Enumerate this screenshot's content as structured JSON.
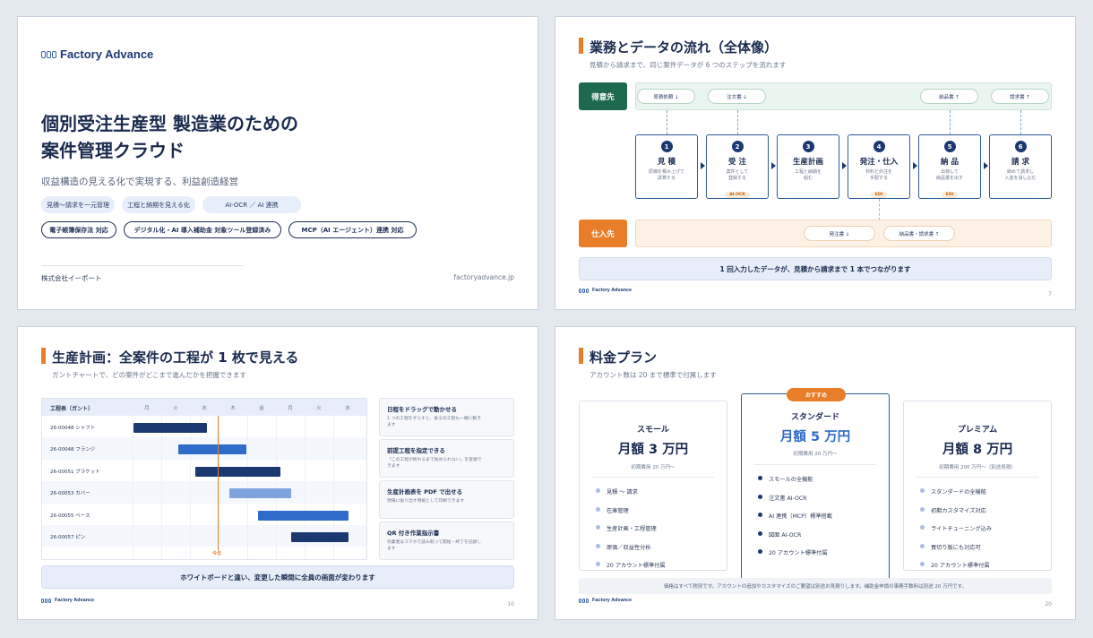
{
  "slide1": {
    "logo_text": "Factory Advance",
    "title_line1": "個別受注生産型 製造業のための",
    "title_line2": "案件管理クラウド",
    "subtitle": "収益構造の見える化で実現する、利益創造経営",
    "tags_light": [
      "見積〜請求を一元管理",
      "工程と納期を見える化",
      "AI-OCR ／ AI 連携"
    ],
    "tags_outline": [
      "電子帳簿保存法 対応",
      "デジタル化・AI 導入補助金 対象ツール登録済み",
      "MCP（AI エージェント）連携 対応"
    ],
    "company": "株式会社イーポート",
    "url": "factoryadvance.jp"
  },
  "slide2": {
    "title": "業務とデータの流れ（全体像）",
    "subtitle": "見積から請求まで、同じ案件データが 6 つのステップを流れます",
    "customer_label": "得意先",
    "supplier_label": "仕入先",
    "customer_chips": [
      "見積依頼 ↓",
      "注文書 ↓",
      "納品書 ↑",
      "請求書 ↑"
    ],
    "supplier_chips": [
      "発注書 ↓",
      "納品書・請求書 ↑"
    ],
    "steps": [
      {
        "num": "1",
        "name": "見 積",
        "desc1": "原価を積み上げて",
        "desc2": "試算する",
        "tag": ""
      },
      {
        "num": "2",
        "name": "受 注",
        "desc1": "案件として",
        "desc2": "登録する",
        "tag": "AI-OCR"
      },
      {
        "num": "3",
        "name": "生産計画",
        "desc1": "工程と納期を",
        "desc2": "組む",
        "tag": ""
      },
      {
        "num": "4",
        "name": "発注・仕入",
        "desc1": "材料と外注を",
        "desc2": "手配する",
        "tag": "EDI"
      },
      {
        "num": "5",
        "name": "納 品",
        "desc1": "出荷して",
        "desc2": "納品書を出す",
        "tag": "EDI"
      },
      {
        "num": "6",
        "name": "請 求",
        "desc1": "締めて請求し",
        "desc2": "入金を消し込む",
        "tag": ""
      }
    ],
    "banner": "1 回入力したデータが、見積から請求まで 1 本でつながります",
    "footer_logo": "Factory Advance",
    "page": "7"
  },
  "slide3": {
    "title": "生産計画：全案件の工程が 1 枚で見える",
    "subtitle": "ガントチャートで、どの案件がどこまで進んだかを把握できます",
    "gantt_header": "工程表（ガント）",
    "days": [
      "月",
      "火",
      "水",
      "木",
      "金",
      "月",
      "火",
      "水"
    ],
    "rows": [
      "26-00048 シャフト",
      "26-00048 フランジ",
      "26-00051 ブラケット",
      "26-00053 カバー",
      "26-00055 ベース",
      "26-00057 ピン"
    ],
    "today_label": "今日",
    "features": [
      {
        "title": "日程をドラッグで動かせる",
        "desc1": "1 つの工程をずらすと、後ろの工程も一緒に動き",
        "desc2": "ます"
      },
      {
        "title": "前提工程を指定できる",
        "desc1": "「この工程が終わるまで始められない」を登録で",
        "desc2": "きます"
      },
      {
        "title": "生産計画表を PDF で出せる",
        "desc1": "現場に貼り出す用紙として印刷できます",
        "desc2": ""
      },
      {
        "title": "QR 付き作業指示書",
        "desc1": "作業者はスマホで読み取って開始・終了を記録し",
        "desc2": "ます"
      }
    ],
    "banner": "ホワイトボードと違い、変更した瞬間に全員の画面が変わります",
    "footer_logo": "Factory Advance",
    "page": "10"
  },
  "slide4": {
    "title": "料金プラン",
    "subtitle": "アカウント数は 20 まで標準で付属します",
    "badge": "おすすめ",
    "plans": [
      {
        "name": "スモール",
        "price": "月額 3 万円",
        "fee": "初期費用 20 万円〜",
        "items": [
          "見積 〜 請求",
          "在庫管理",
          "生産計画・工程管理",
          "原価／収益性分析",
          "20 アカウント標準付属"
        ]
      },
      {
        "name": "スタンダード",
        "price": "月額 5 万円",
        "fee": "初期費用 20 万円〜",
        "items": [
          "スモールの全機能",
          "注文書 AI-OCR",
          "AI 連携（MCP）標準搭載",
          "図面 AI-OCR",
          "20 アカウント標準付属"
        ]
      },
      {
        "name": "プレミアム",
        "price": "月額 8 万円",
        "fee": "初期費用 200 万円〜（別途見積）",
        "items": [
          "スタンダードの全機能",
          "初期カスタマイズ対応",
          "ライトチューニング込み",
          "買切り版にも対応可",
          "20 アカウント標準付属"
        ]
      }
    ],
    "note": "価格はすべて税別です。アカウントの追加やカスタマイズのご要望は別途お見積りします。補助金申請の事務手数料は別途 20 万円です。",
    "footer_logo": "Factory Advance",
    "page": "20"
  },
  "colors": {
    "navy": "#1a2b4f",
    "accent_orange": "#e97e2a",
    "customer_green": "#1e6a4e",
    "bar_dark": "#1b3970",
    "bar_mid": "#2f6bc9",
    "bar_light": "#7fa4dd"
  }
}
